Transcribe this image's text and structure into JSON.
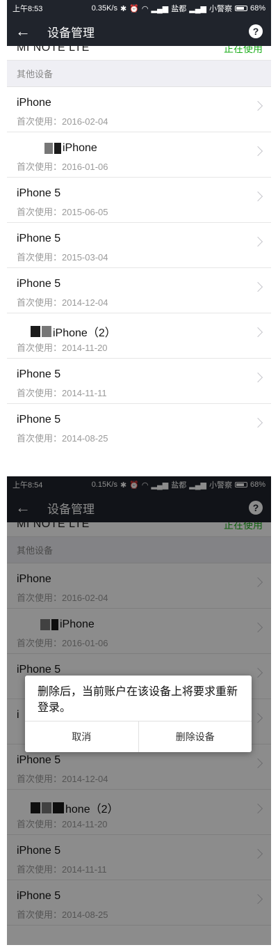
{
  "screens": [
    {
      "status": {
        "time": "上午8:53",
        "speed": "0.35K/s",
        "carrier1": "盐都",
        "carrier2": "小警察",
        "battery": "68%"
      },
      "header": {
        "title": "设备管理"
      },
      "current_device": {
        "name": "MI NOTE LTE",
        "status": "正在使用"
      },
      "section_title": "其他设备",
      "devices": [
        {
          "name": "iPhone",
          "date": "首次使用：2016-02-04"
        },
        {
          "name": "iPhone",
          "date": "首次使用：2016-01-06"
        },
        {
          "name": "iPhone 5",
          "date": "首次使用：2015-06-05"
        },
        {
          "name": "iPhone 5",
          "date": "首次使用：2015-03-04"
        },
        {
          "name": "iPhone 5",
          "date": "首次使用：2014-12-04"
        },
        {
          "name": "iPhone（2）",
          "date": "首次使用：2014-11-20"
        },
        {
          "name": "iPhone 5",
          "date": "首次使用：2014-11-11"
        },
        {
          "name": "iPhone 5",
          "date": "首次使用：2014-08-25"
        }
      ]
    },
    {
      "status": {
        "time": "上午8:54",
        "speed": "0.15K/s",
        "carrier1": "盐都",
        "carrier2": "小警察",
        "battery": "68%"
      },
      "header": {
        "title": "设备管理"
      },
      "current_device": {
        "name": "MI NOTE LTE",
        "status": "正在使用"
      },
      "section_title": "其他设备",
      "devices": [
        {
          "name": "iPhone",
          "date": "首次使用：2016-02-04"
        },
        {
          "name": "iPhone",
          "date": "首次使用：2016-01-06"
        },
        {
          "name": "iPhone 5",
          "date": ""
        },
        {
          "name": "i",
          "date": ""
        },
        {
          "name": "iPhone 5",
          "date": "首次使用：2014-12-04"
        },
        {
          "name": "hone（2）",
          "date": "首次使用：2014-11-20"
        },
        {
          "name": "iPhone 5",
          "date": "首次使用：2014-11-11"
        },
        {
          "name": "iPhone 5",
          "date": "首次使用：2014-08-25"
        }
      ],
      "dialog": {
        "message": "删除后，当前账户在该设备上将要求重新登录。",
        "cancel": "取消",
        "delete": "删除设备"
      }
    }
  ],
  "colors": {
    "header_bg": "#20242c",
    "accent_green": "#1aad19",
    "section_bg": "#efeff4"
  },
  "icons": [
    "back-arrow-icon",
    "help-icon",
    "chevron-right-icon",
    "bluetooth-icon",
    "alarm-icon",
    "wifi-icon",
    "signal-icon",
    "battery-icon"
  ]
}
